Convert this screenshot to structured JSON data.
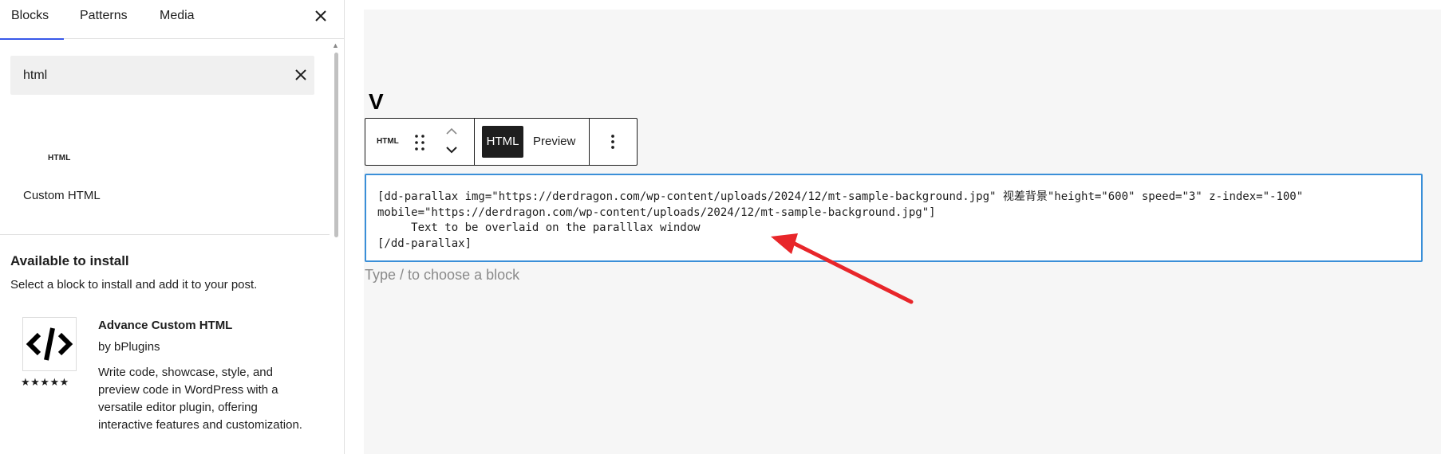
{
  "sidebar": {
    "tabs": [
      {
        "label": "Blocks"
      },
      {
        "label": "Patterns"
      },
      {
        "label": "Media"
      }
    ],
    "search": {
      "value": "html"
    },
    "results": [
      {
        "icon_text": "HTML",
        "label": "Custom HTML"
      }
    ],
    "available": {
      "title": "Available to install",
      "description": "Select a block to install and add it to your post.",
      "plugin": {
        "name": "Advance Custom HTML",
        "author": "by bPlugins",
        "rating": "★★★★★",
        "description": "Write code, showcase, style, and preview code in WordPress with a versatile editor plugin, offering interactive features and customization."
      }
    }
  },
  "editor": {
    "heading": "V",
    "toolbar": {
      "block_type": "HTML",
      "html_label": "HTML",
      "preview_label": "Preview"
    },
    "html_block": {
      "code": "[dd-parallax img=\"https://derdragon.com/wp-content/uploads/2024/12/mt-sample-background.jpg\" 视差背景\"height=\"600\" speed=\"3\" z-index=\"-100\"\nmobile=\"https://derdragon.com/wp-content/uploads/2024/12/mt-sample-background.jpg\"]\n     Text to be overlaid on the paralllax window\n[/dd-parallax]"
    },
    "placeholder": "Type / to choose a block"
  },
  "colors": {
    "accent": "#3858e9",
    "focus_border": "#3a8fd8",
    "annotation_arrow": "#e8262a"
  },
  "icons": [
    "close-icon",
    "code-icon",
    "drag-handle-icon",
    "chevron-up-icon",
    "chevron-down-icon",
    "more-vertical-icon",
    "arrow-annotation-icon"
  ]
}
